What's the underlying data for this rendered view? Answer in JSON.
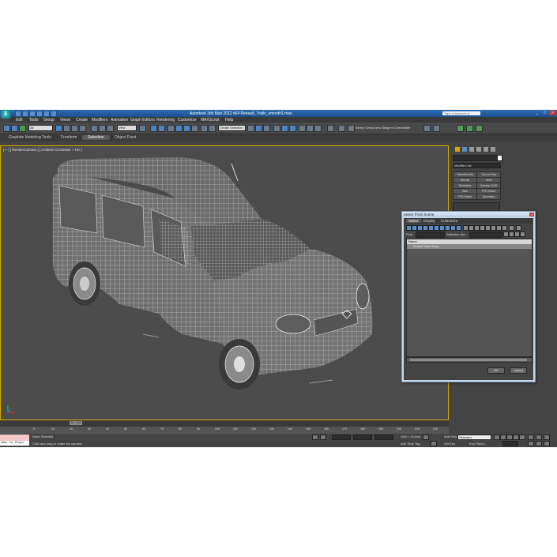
{
  "window": {
    "title": "Autodesk 3ds Max 2012 x64     Renault_Trafic_smooth1.max",
    "search_placeholder": "Type a keyword or phrase"
  },
  "menu": [
    "Edit",
    "Tools",
    "Group",
    "Views",
    "Create",
    "Modifiers",
    "Animation",
    "Graph Editors",
    "Rendering",
    "Customize",
    "MAXScript",
    "Help"
  ],
  "toolbar": {
    "selection_filter": "All",
    "reference_coord": "View",
    "named_selection": "Create Selection Se",
    "extra_label": "elivery Check  lenc Stage vi  CheckMate"
  },
  "ribbon": {
    "tabs": [
      "Graphite Modeling Tools",
      "Freeform",
      "Selection",
      "Object Paint"
    ],
    "active": "Selection"
  },
  "viewport": {
    "label": "[ + ] [ RenderCamera ] [ Ambient Occlusion + HV ]"
  },
  "command_panel": {
    "modifier_list": "Modifier List",
    "modifiers": [
      "TurboSmooth",
      "Turn to Poly",
      "Normal",
      "Shell",
      "Symmetry",
      "Unwrap UVW",
      "Skin",
      "FFD Select",
      "FFD Select",
      "Symmetry"
    ]
  },
  "dialog": {
    "title": "Select From Scene",
    "tabs": [
      "Select",
      "Display",
      "Customize"
    ],
    "active_tab": "Select",
    "find_label": "Find:",
    "selection_set_label": "Selection Set:",
    "column_header": "Name",
    "rows": [
      "Renault Trafic Group"
    ],
    "ok_label": "OK",
    "cancel_label": "Cancel"
  },
  "timeline": {
    "frame_display": "26 / 100",
    "ticks": [
      "0",
      "10",
      "20",
      "30",
      "40",
      "50",
      "60",
      "70",
      "80",
      "90",
      "100",
      "110",
      "120",
      "130",
      "140",
      "150",
      "160",
      "170",
      "180",
      "190",
      "200",
      "210",
      "220"
    ]
  },
  "status": {
    "listener": "Max to Physc",
    "selection": "None Selected",
    "prompt": "Click and drag to rotate the camera",
    "grid": "Grid = 10,0cm",
    "add_time_tag": "Add Time Tag",
    "auto_key": "Auto Key",
    "selected": "Selected",
    "set_key": "Set Key",
    "key_filters": "Key Filters..."
  }
}
